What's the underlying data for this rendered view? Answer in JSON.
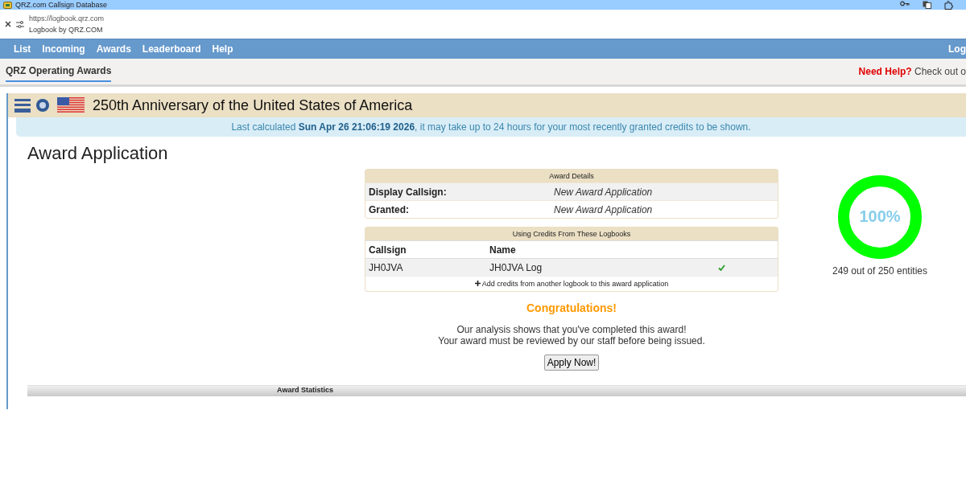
{
  "browser": {
    "title": "QRZ.com Callsign Database",
    "url": "https://logbook.qrz.com",
    "page_title": "Logbook by QRZ.COM"
  },
  "nav": {
    "items": [
      {
        "label": "List"
      },
      {
        "label": "Incoming"
      },
      {
        "label": "Awards"
      },
      {
        "label": "Leaderboard"
      },
      {
        "label": "Help"
      }
    ],
    "right": "Log"
  },
  "subheader": {
    "tabs": [
      {
        "label": "QRZ Operating Awards",
        "selected": true
      }
    ],
    "help_label": "Need Help?",
    "help_text": "Check out o"
  },
  "banner": {
    "title": "250th Anniversary of the United States of America",
    "notice": "Last calculated **Sun Apr 26 21:06:19 2026**, it may take up to 24 hours for your most recently granted credits to be shown."
  },
  "heading": "Award Application",
  "award_details": {
    "title": "Award Details",
    "rows": [
      {
        "label": "Display Callsign:",
        "value": "New Award Application"
      },
      {
        "label": "Granted:",
        "value": "New Award Application"
      }
    ]
  },
  "logbooks": {
    "title": "Using Credits From These Logbooks",
    "columns": [
      "Callsign",
      "Name"
    ],
    "rows": [
      {
        "callsign": "JH0JVA",
        "name": "JH0JVA Log",
        "included": true
      }
    ],
    "add_link": "Add credits from another logbook to this award application"
  },
  "progress": {
    "percent": "100%",
    "level": 1,
    "caption": "249 out of 250 entities"
  },
  "result": {
    "title": "Congratulations!",
    "message_lines": [
      "Our analysis shows that you've completed this award!",
      "Your award must be reviewed by our staff before being issued."
    ],
    "button": "Apply Now!"
  },
  "statistics": {
    "title": "Award Statistics"
  }
}
